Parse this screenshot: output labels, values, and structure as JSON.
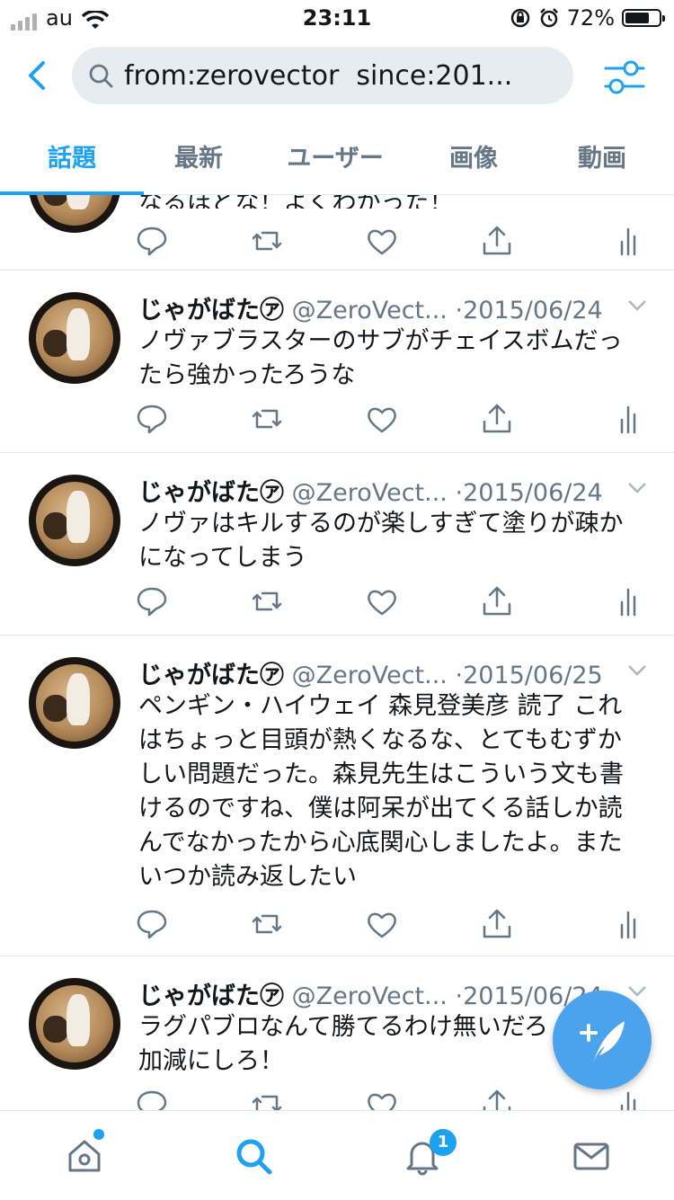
{
  "status": {
    "carrier": "au",
    "time": "23:11",
    "battery": "72%",
    "battery_level": 0.72
  },
  "search": {
    "query": "from:zerovector  since:201..."
  },
  "tabs": [
    "話題",
    "最新",
    "ユーザー",
    "画像",
    "動画"
  ],
  "partial_tweet": {
    "text": "なるほどな！よくわかった！"
  },
  "tweets": [
    {
      "name": "じゃがばた㋐",
      "handle": "@ZeroVect...",
      "dot": "·",
      "date": "2015/06/24",
      "lines": [
        "ノヴァブラスターのサブがチェイスボムだっ",
        "たら強かったろうな"
      ]
    },
    {
      "name": "じゃがばた㋐",
      "handle": "@ZeroVect...",
      "dot": "·",
      "date": "2015/06/24",
      "lines": [
        "ノヴァはキルするのが楽しすぎて塗りが疎か",
        "になってしまう"
      ]
    },
    {
      "name": "じゃがばた㋐",
      "handle": "@ZeroVect...",
      "dot": "·",
      "date": "2015/06/25",
      "lines": [
        "ペンギン・ハイウェイ 森見登美彦 読了 これ",
        "はちょっと目頭が熱くなるな、とてもむずか",
        "しい問題だった。森見先生はこういう文も書",
        "けるのですね、僕は阿呆が出てくる話しか読",
        "んでなかったから心底関心しましたよ。また",
        "いつか読み返したい"
      ]
    },
    {
      "name": "じゃがばた㋐",
      "handle": "@ZeroVect...",
      "dot": "·",
      "date": "2015/06/24",
      "lines": [
        "ラグパブロなんて勝てるわけ無いだろ",
        "加減にしろ！"
      ]
    }
  ],
  "notifications": {
    "badge": "1"
  },
  "colors": {
    "accent": "#1da1f2",
    "fab": "#4aa3ec",
    "secondary_text": "#657786"
  }
}
